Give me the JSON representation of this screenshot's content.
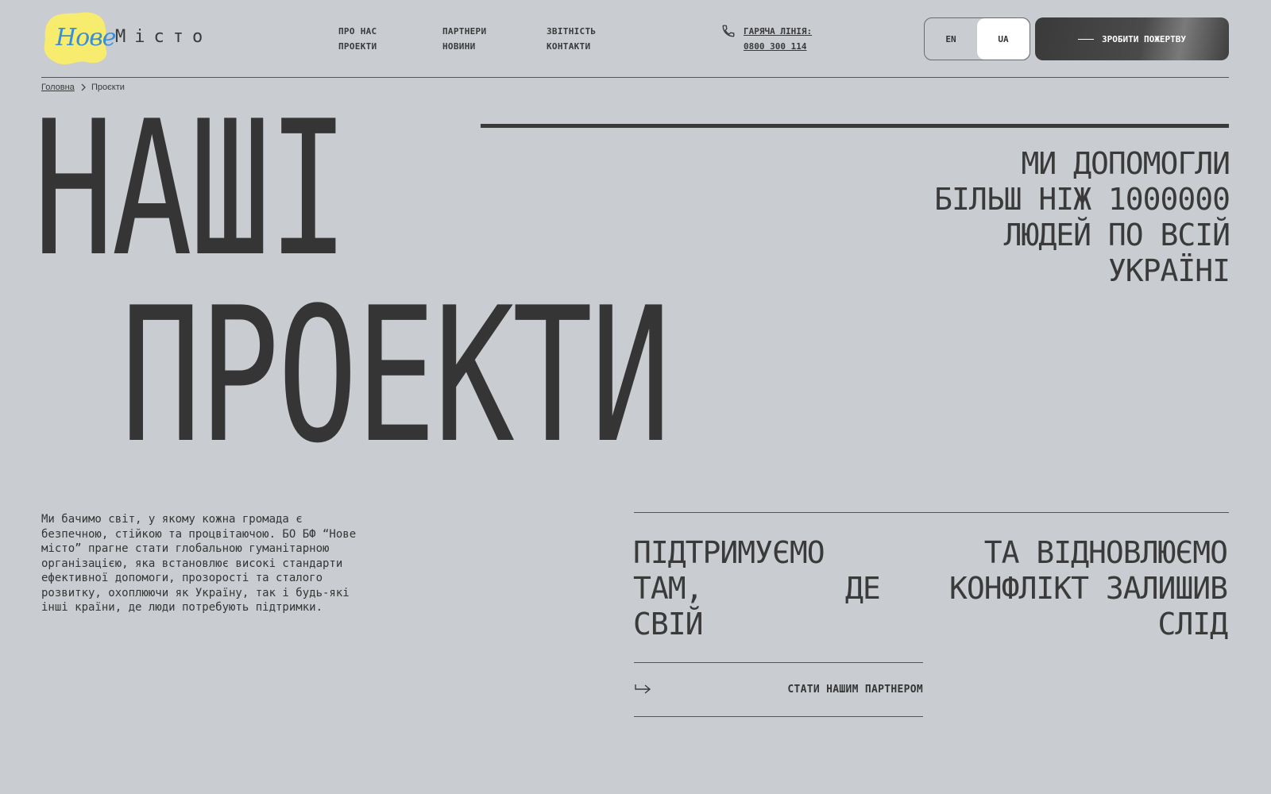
{
  "header": {
    "logo": {
      "nove": "Нове",
      "misto": "Місто",
      "accent_color": "#f7ec6e",
      "nove_color": "#3a8ed6"
    },
    "nav": [
      {
        "label": "ПРО НАС"
      },
      {
        "label": "ПРОЕКТИ"
      },
      {
        "label": "ПАРТНЕРИ"
      },
      {
        "label": "НОВИНИ"
      },
      {
        "label": "ЗВІТНІСТЬ"
      },
      {
        "label": "КОНТАКТИ"
      }
    ],
    "hotline": {
      "label": "ГАРЯЧА ЛІНІЯ:",
      "number": "0800 300 114",
      "icon": "phone-icon"
    },
    "languages": {
      "en": "EN",
      "ua": "UA",
      "active": "UA"
    },
    "donate_label": "ЗРОБИТИ ПОЖЕРТВУ"
  },
  "breadcrumb": {
    "home": "Головна",
    "current": "Проєкти"
  },
  "hero": {
    "title_line1": "НАШІ",
    "title_line2": "ПРОЕКТИ",
    "stat_lines": [
      "МИ ДОПОМОГЛИ",
      "БІЛЬШ НІЖ 1000000",
      "ЛЮДЕЙ ПО ВСІЙ",
      "УКРАЇНІ"
    ]
  },
  "mission": {
    "lines": [
      "Ми бачимо світ, у якому кожна громада є",
      "безпечною, стійкою та процвітаючою. БО БФ “Нове",
      "місто” прагне стати глобальною гуманітарною",
      "організацією, яка встановлює високі стандарти",
      "ефективної допомоги, прозорості та сталого",
      "розвитку, охоплюючи як Україну, так і будь-які",
      "інші країни, де люди потребують підтримки."
    ]
  },
  "support": {
    "left": {
      "w1": "ПІДТРИМУЄМО",
      "w2": "ТАМ,",
      "w3": "ДЕ",
      "w4": "СВІЙ"
    },
    "right": {
      "line1": "ТА ВІДНОВЛЮЄМО",
      "line2": "КОНФЛІКТ ЗАЛИШИВ",
      "line3": "СЛІД"
    }
  },
  "cta": {
    "label": "СТАТИ НАШИМ ПАРТНЕРОМ",
    "icon": "arrow-right-icon"
  }
}
